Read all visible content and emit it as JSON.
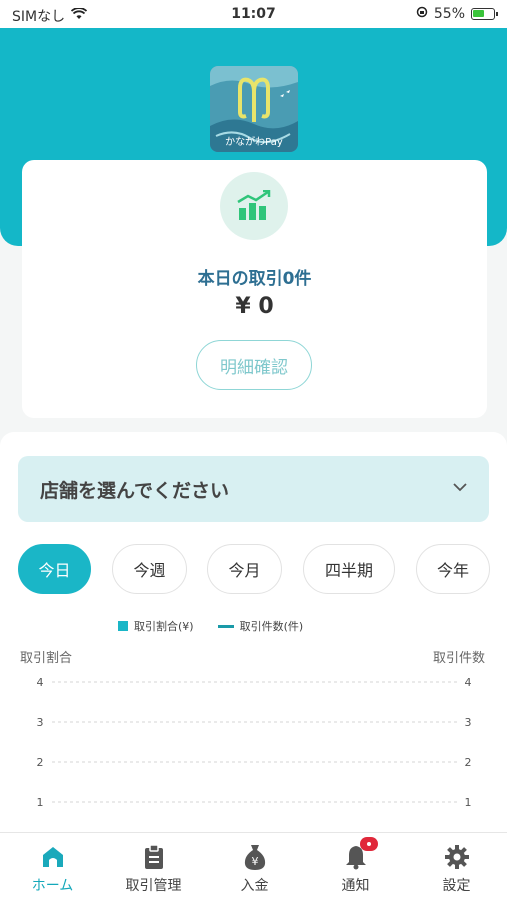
{
  "status_bar": {
    "carrier": "SIMなし",
    "time": "11:07",
    "battery": "55%",
    "battery_level": 0.55
  },
  "logo": {
    "text": "かながわPay"
  },
  "summary": {
    "title": "本日の取引0件",
    "amount": "¥ 0",
    "detail_button": "明細確認"
  },
  "store_select": {
    "label": "店舗を選んでください"
  },
  "period_tabs": [
    {
      "label": "今日",
      "active": true
    },
    {
      "label": "今週",
      "active": false
    },
    {
      "label": "今月",
      "active": false
    },
    {
      "label": "四半期",
      "active": false
    },
    {
      "label": "今年",
      "active": false
    }
  ],
  "chart_data": {
    "type": "bar",
    "categories": [],
    "series": [
      {
        "name": "取引割合(¥)",
        "values": []
      },
      {
        "name": "取引件数(件)",
        "values": []
      }
    ],
    "ylabel_left": "取引割合",
    "ylabel_right": "取引件数",
    "left_ticks": [
      "1",
      "2",
      "3",
      "4"
    ],
    "right_ticks": [
      "1",
      "2",
      "3",
      "4"
    ],
    "ylim": [
      0,
      4
    ],
    "grid": true,
    "legend": "top"
  },
  "tabs": [
    {
      "label": "ホーム",
      "icon": "home-icon",
      "active": true
    },
    {
      "label": "取引管理",
      "icon": "clipboard-icon",
      "active": false
    },
    {
      "label": "入金",
      "icon": "money-bag-icon",
      "active": false
    },
    {
      "label": "通知",
      "icon": "bell-icon",
      "active": false
    },
    {
      "label": "設定",
      "icon": "gear-icon",
      "active": false
    }
  ],
  "colors": {
    "primary": "#14b7c8",
    "title_blue": "#2e6f92",
    "select_bg": "#d8f0f2",
    "badge_red": "#e0283a"
  }
}
